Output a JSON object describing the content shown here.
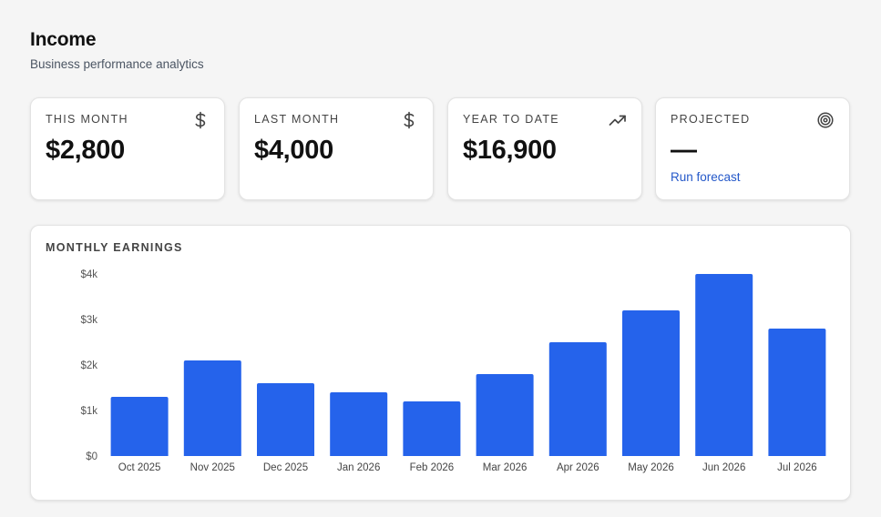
{
  "header": {
    "title": "Income",
    "subtitle": "Business performance analytics"
  },
  "cards": [
    {
      "label": "THIS MONTH",
      "value": "$2,800",
      "icon": "dollar-icon"
    },
    {
      "label": "LAST MONTH",
      "value": "$4,000",
      "icon": "dollar-icon"
    },
    {
      "label": "YEAR TO DATE",
      "value": "$16,900",
      "icon": "trending-up-icon"
    },
    {
      "label": "PROJECTED",
      "value": "—",
      "icon": "target-icon",
      "link": "Run forecast"
    }
  ],
  "colors": {
    "bar": "#2563eb",
    "link": "#2458c9"
  },
  "chart_data": {
    "type": "bar",
    "title": "MONTHLY EARNINGS",
    "categories": [
      "Oct 2025",
      "Nov 2025",
      "Dec 2025",
      "Jan 2026",
      "Feb 2026",
      "Mar 2026",
      "Apr 2026",
      "May 2026",
      "Jun 2026",
      "Jul 2026"
    ],
    "values": [
      1300,
      2100,
      1600,
      1400,
      1200,
      1800,
      2500,
      3200,
      4000,
      2800
    ],
    "yticks": [
      "$0",
      "$1k",
      "$2k",
      "$3k",
      "$4k"
    ],
    "ylim": [
      0,
      4000
    ],
    "grid": false,
    "xlabel": "",
    "ylabel": ""
  }
}
